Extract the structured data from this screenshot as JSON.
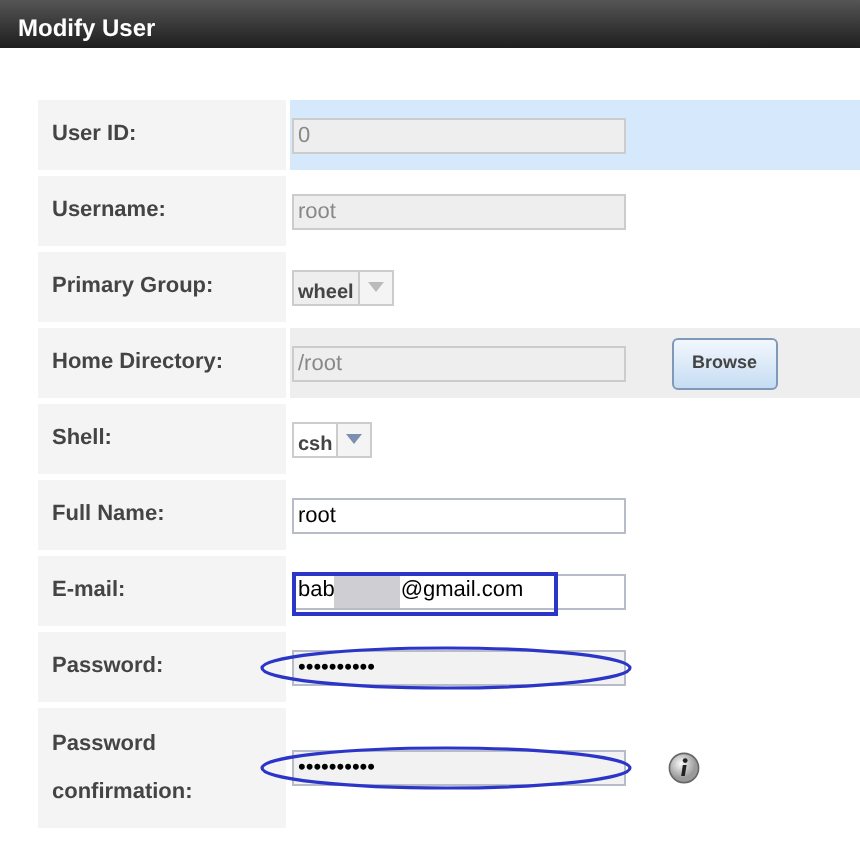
{
  "window": {
    "title": "Modify User"
  },
  "fields": [
    {
      "label": "User ID:",
      "kind": "text",
      "value": "0",
      "disabled": true,
      "highlighted": true,
      "shaded": false
    },
    {
      "label": "Username:",
      "kind": "text",
      "value": "root",
      "disabled": true,
      "highlighted": false,
      "shaded": false
    },
    {
      "label": "Primary Group:",
      "kind": "select",
      "value": "wheel",
      "disabled": true,
      "highlighted": false,
      "shaded": false
    },
    {
      "label": "Home Directory:",
      "kind": "text",
      "value": "/root",
      "disabled": true,
      "highlighted": false,
      "shaded": true,
      "button": "Browse"
    },
    {
      "label": "Shell:",
      "kind": "select",
      "value": "csh",
      "disabled": false,
      "highlighted": false,
      "shaded": false
    },
    {
      "label": "Full Name:",
      "kind": "text",
      "value": "root",
      "disabled": false,
      "highlighted": false,
      "shaded": false
    },
    {
      "label": "E-mail:",
      "kind": "redacted",
      "value_start": "bab",
      "value_end": "@gmail.com",
      "disabled": false,
      "highlighted": false,
      "shaded": false,
      "boxed": true
    },
    {
      "label": "Password:",
      "kind": "password",
      "value": "••••••••••",
      "disabled": false,
      "highlighted": false,
      "shaded": false,
      "circled": true
    },
    {
      "label": "Password confirmation:",
      "kind": "password",
      "value": "••••••••••",
      "disabled": false,
      "highlighted": false,
      "shaded": false,
      "circled": true,
      "info": true
    }
  ]
}
